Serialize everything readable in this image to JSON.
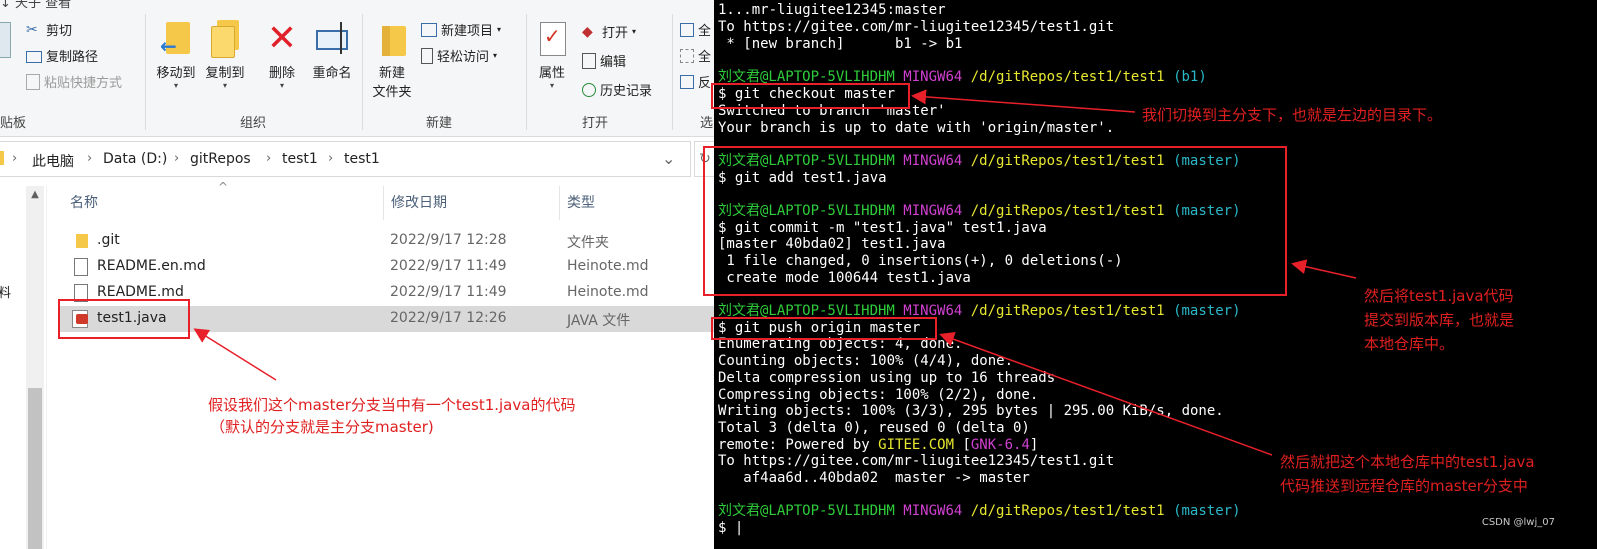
{
  "ribbon": {
    "top_cut": "↓ 天子   查看",
    "clipboard": {
      "paste_partial": "贴",
      "cut": "剪切",
      "copy_path": "复制路径",
      "paste_shortcut": "粘贴快捷方式",
      "group_partial": "贴板"
    },
    "organize": {
      "move_to": "移动到",
      "copy_to": "复制到",
      "delete": "删除",
      "rename": "重命名",
      "group": "组织"
    },
    "new": {
      "new_folder_l1": "新建",
      "new_folder_l2": "文件夹",
      "new_item": "新建项目",
      "easy_access": "轻松访问",
      "group": "新建"
    },
    "open": {
      "properties": "属性",
      "open": "打开",
      "edit": "编辑",
      "history": "历史记录",
      "group": "打开"
    },
    "select_partial": {
      "all": "全",
      "none": "全",
      "invert": "反",
      "group": "选"
    }
  },
  "address": {
    "crumbs": [
      "此电脑",
      "Data (D:)",
      "gitRepos",
      "test1",
      "test1"
    ]
  },
  "nav": {
    "partial_label": "料"
  },
  "columns": {
    "name": "名称",
    "modified": "修改日期",
    "type": "类型"
  },
  "files": [
    {
      "name": ".git",
      "modified": "2022/9/17 12:28",
      "type": "文件夹",
      "icon": "folder-icon"
    },
    {
      "name": "README.en.md",
      "modified": "2022/9/17 11:49",
      "type": "Heinote.md",
      "icon": "document-icon"
    },
    {
      "name": "README.md",
      "modified": "2022/9/17 11:49",
      "type": "Heinote.md",
      "icon": "document-icon"
    },
    {
      "name": "test1.java",
      "modified": "2022/9/17 12:26",
      "type": "JAVA 文件",
      "icon": "java-file-icon"
    }
  ],
  "annotations": {
    "left_l1": "假设我们这个master分支当中有一个test1.java的代码",
    "left_l2": "（默认的分支就是主分支master)",
    "checkout": "我们切换到主分支下，也就是左边的目录下。",
    "commit_l1": "然后将test1.java代码",
    "commit_l2": "提交到版本库，也就是",
    "commit_l3": "本地仓库中。",
    "push_l1": "然后就把这个本地仓库中的test1.java",
    "push_l2": "代码推送到远程仓库的master分支中"
  },
  "terminal": {
    "l01": "1...mr-liugitee12345:master",
    "l02": "To https://gitee.com/mr-liugitee12345/test1.git",
    "l03": " * [new branch]      b1 -> b1",
    "user": "刘文君@LAPTOP-5VLIHDHM",
    "shell": "MINGW64",
    "path": "/d/gitRepos/test1/test1",
    "branch_b1": "(b1)",
    "branch_master": "(master)",
    "cmd_checkout": "$ git checkout master",
    "out_switched": "Switched to branch 'master'",
    "out_uptodate": "Your branch is up to date with 'origin/master'.",
    "cmd_add": "$ git add test1.java",
    "cmd_commit": "$ git commit -m \"test1.java\" test1.java",
    "out_c1": "[master 40bda02] test1.java",
    "out_c2": " 1 file changed, 0 insertions(+), 0 deletions(-)",
    "out_c3": " create mode 100644 test1.java",
    "cmd_push": "$ git push origin master",
    "p1": "Enumerating objects: 4, done.",
    "p2": "Counting objects: 100% (4/4), done.",
    "p3": "Delta compression using up to 16 threads",
    "p4": "Compressing objects: 100% (2/2), done.",
    "p5": "Writing objects: 100% (3/3), 295 bytes | 295.00 KiB/s, done.",
    "p6": "Total 3 (delta 0), reused 0 (delta 0)",
    "p7_a": "remote: Powered by ",
    "p7_b": "GITEE.COM",
    "p7_c": " [",
    "p7_d": "GNK-6.4",
    "p7_e": "]",
    "p8": "To https://gitee.com/mr-liugitee12345/test1.git",
    "p9": "   af4aa6d..40bda02  master -> master",
    "prompt_end": "$ |",
    "watermark": "CSDN @lwj_07"
  },
  "colors": {
    "annotation_red": "#e02020",
    "terminal_bg": "#000000",
    "prompt_green": "#2ecc3a",
    "mingw_magenta": "#d040d0",
    "path_yellow": "#e8e830",
    "branch_cyan": "#2ab8c8"
  }
}
